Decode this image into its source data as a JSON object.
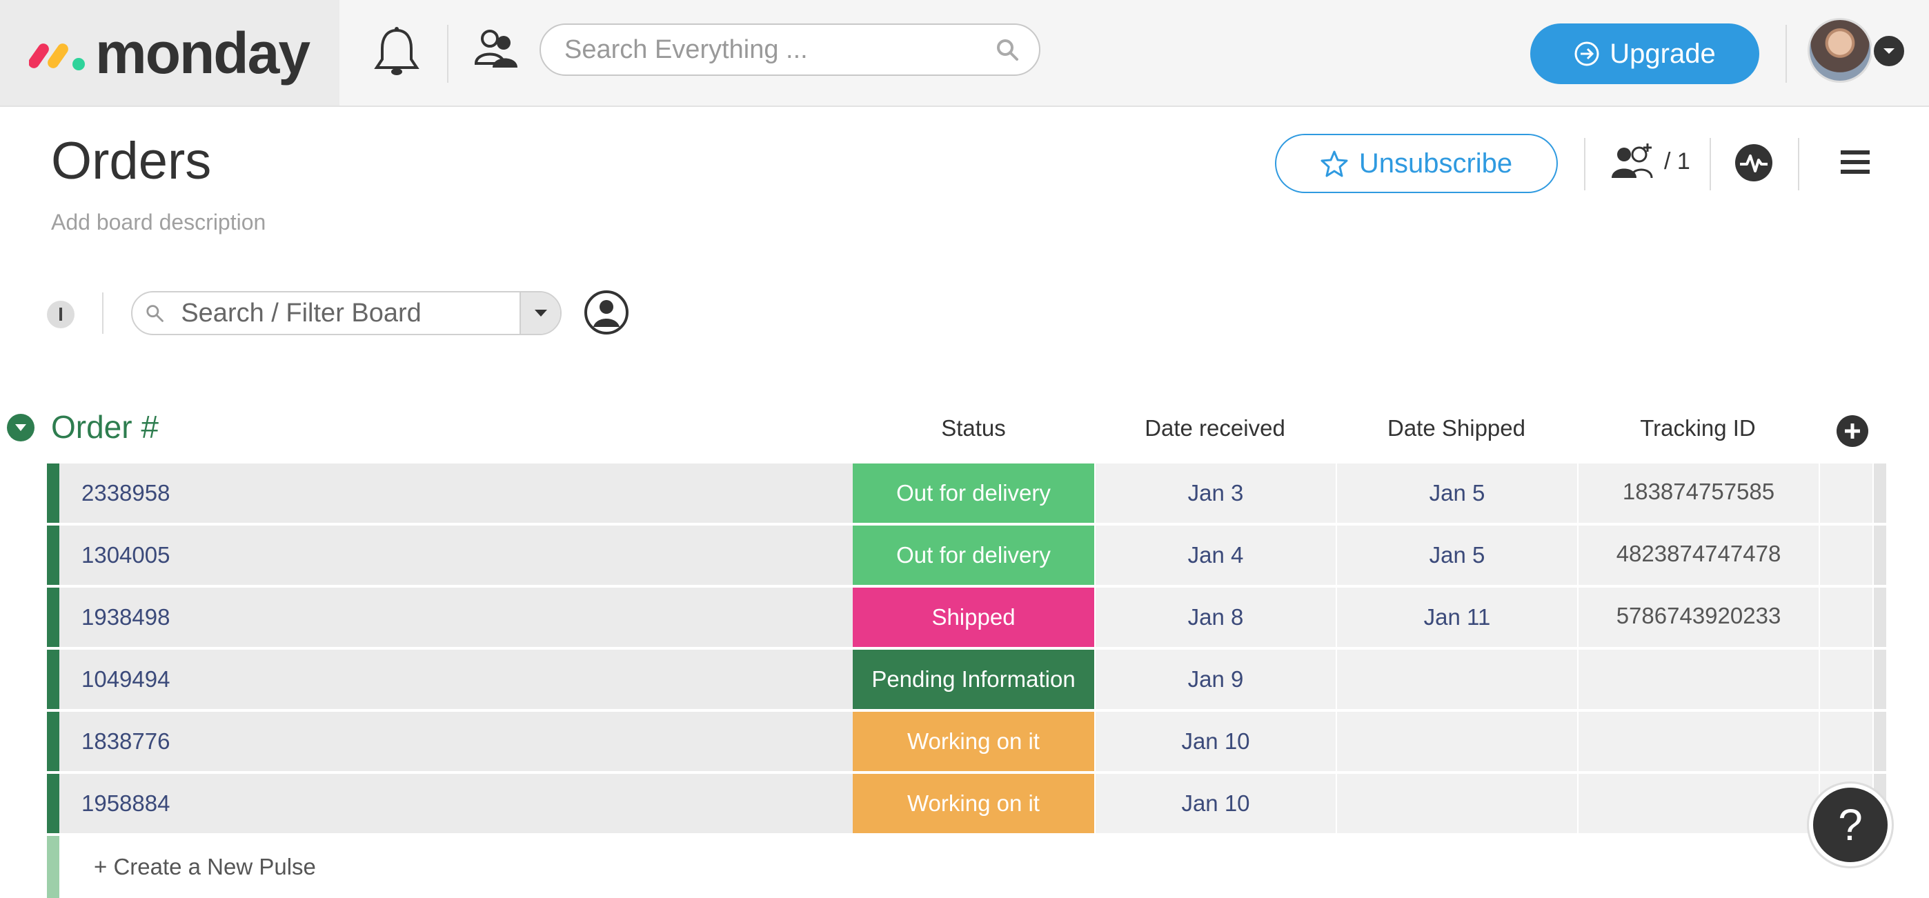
{
  "app": {
    "brand": "monday",
    "search_placeholder": "Search Everything ...",
    "upgrade_label": "Upgrade"
  },
  "board": {
    "title": "Orders",
    "description_placeholder": "Add board description",
    "unsubscribe_label": "Unsubscribe",
    "members_count": "/ 1",
    "info_label": "I",
    "filter_placeholder": "Search / Filter Board"
  },
  "group": {
    "title": "Order #",
    "columns": {
      "status": "Status",
      "date_received": "Date received",
      "date_shipped": "Date Shipped",
      "tracking_id": "Tracking ID"
    },
    "rows": [
      {
        "name": "2338958",
        "status": "Out for delivery",
        "status_color": "#5ac57a",
        "date_received": "Jan 3",
        "date_shipped": "Jan 5",
        "tracking_id": "183874757585"
      },
      {
        "name": "1304005",
        "status": "Out for delivery",
        "status_color": "#5ac57a",
        "date_received": "Jan 4",
        "date_shipped": "Jan 5",
        "tracking_id": "4823874747478"
      },
      {
        "name": "1938498",
        "status": "Shipped",
        "status_color": "#e8398a",
        "date_received": "Jan 8",
        "date_shipped": "Jan 11",
        "tracking_id": "5786743920233"
      },
      {
        "name": "1049494",
        "status": "Pending Information",
        "status_color": "#347e4f",
        "date_received": "Jan 9",
        "date_shipped": "",
        "tracking_id": ""
      },
      {
        "name": "1838776",
        "status": "Working on it",
        "status_color": "#f1ae52",
        "date_received": "Jan 10",
        "date_shipped": "",
        "tracking_id": ""
      },
      {
        "name": "1958884",
        "status": "Working on it",
        "status_color": "#f1ae52",
        "date_received": "Jan 10",
        "date_shipped": "",
        "tracking_id": ""
      }
    ],
    "create_label": "+ Create a New Pulse"
  },
  "help_label": "?",
  "colors": {
    "accent": "#2f9ae0",
    "group": "#2e7d4f"
  }
}
